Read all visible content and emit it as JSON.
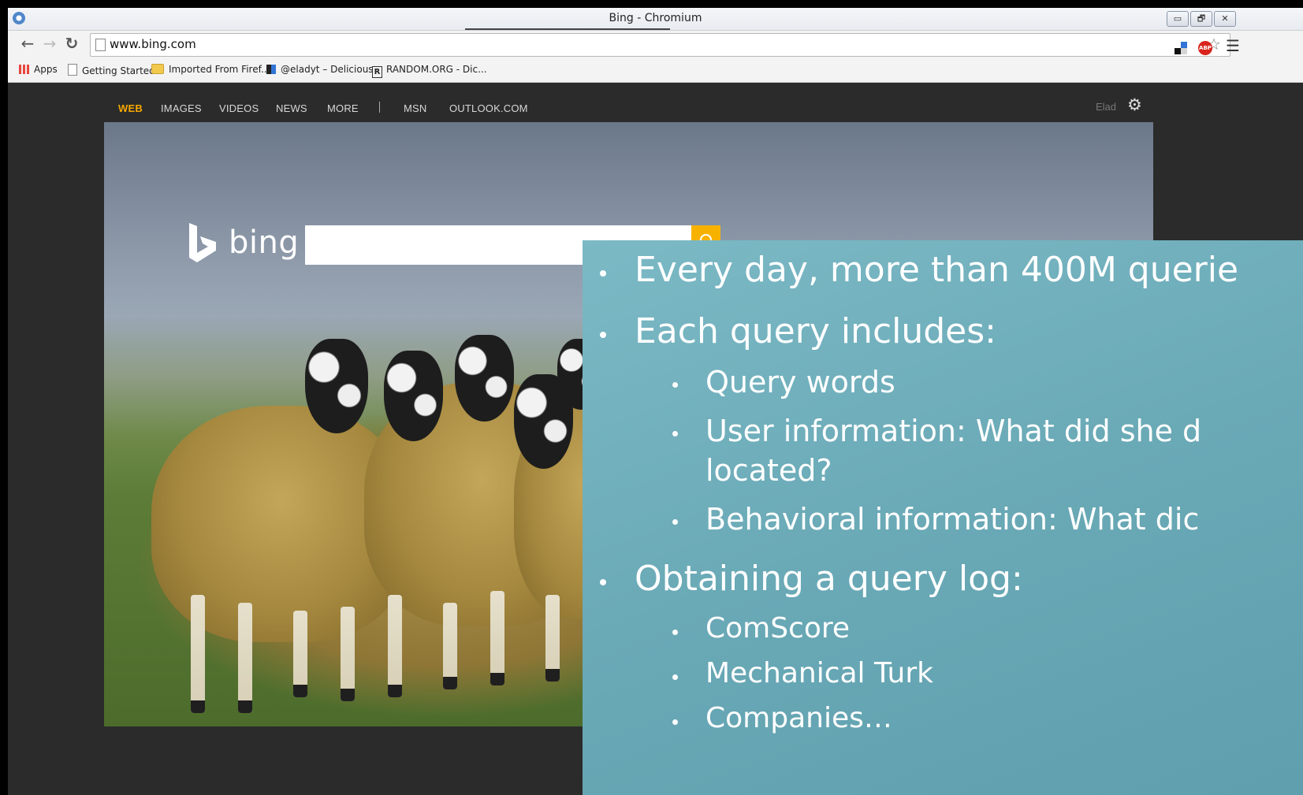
{
  "window": {
    "title": "Bing - Chromium",
    "controls": {
      "minimize": "▭",
      "restore": "🗗",
      "close": "✕"
    }
  },
  "toolbar": {
    "url": "www.bing.com"
  },
  "bookmarks": [
    {
      "label": "Apps",
      "icon": "apps-grid-icon"
    },
    {
      "label": "Getting Started",
      "icon": "page-icon"
    },
    {
      "label": "Imported From Firef...",
      "icon": "folder-icon"
    },
    {
      "label": "@eladyt – Delicious",
      "icon": "delicious-icon"
    },
    {
      "label": "RANDOM.ORG - Dic...",
      "icon": "random-org-icon"
    }
  ],
  "bing": {
    "nav": [
      {
        "label": "WEB",
        "active": true
      },
      {
        "label": "IMAGES"
      },
      {
        "label": "VIDEOS"
      },
      {
        "label": "NEWS"
      },
      {
        "label": "MORE"
      },
      {
        "label": "MSN"
      },
      {
        "label": "OUTLOOK.COM"
      }
    ],
    "user": "Elad",
    "logo_text": "bing",
    "search_value": "",
    "colors": {
      "active_nav": "#f7a800",
      "search_button": "#f7b200",
      "background": "#2b2b2b"
    }
  },
  "slide": {
    "bullets": [
      {
        "text": "Every day, more than 400M querie",
        "level": 1
      },
      {
        "text": "Each query includes:",
        "level": 1
      },
      {
        "text": "Query words",
        "level": 2
      },
      {
        "text": "User information: What did she d",
        "level": 2
      },
      {
        "text": "located?",
        "level": 2,
        "continuation": true
      },
      {
        "text": "Behavioral information: What dic",
        "level": 2
      },
      {
        "text": "Obtaining a query log:",
        "level": 1
      },
      {
        "text": "ComScore",
        "level": 2
      },
      {
        "text": "Mechanical Turk",
        "level": 2
      },
      {
        "text": "Companies…",
        "level": 2
      }
    ],
    "colors": {
      "background": "#6aa9b6",
      "text": "#ffffff"
    }
  }
}
